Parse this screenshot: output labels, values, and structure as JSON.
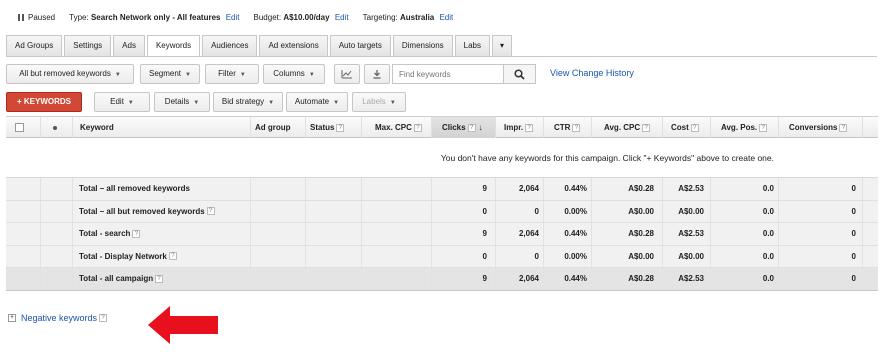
{
  "status": {
    "paused_label": "Paused",
    "type_label": "Type:",
    "type_value": "Search Network only - All features",
    "budget_label": "Budget:",
    "budget_value": "A$10.00/day",
    "targeting_label": "Targeting:",
    "targeting_value": "Australia",
    "edit_label": "Edit"
  },
  "tabs": [
    {
      "label": "Ad Groups"
    },
    {
      "label": "Settings"
    },
    {
      "label": "Ads"
    },
    {
      "label": "Keywords"
    },
    {
      "label": "Audiences"
    },
    {
      "label": "Ad extensions"
    },
    {
      "label": "Auto targets"
    },
    {
      "label": "Dimensions"
    },
    {
      "label": "Labs"
    },
    {
      "label": "▾"
    }
  ],
  "toolbar1": {
    "filter_select": "All but removed keywords",
    "segment": "Segment",
    "filter": "Filter",
    "columns": "Columns",
    "search_placeholder": "Find keywords",
    "view_change_history": "View Change History"
  },
  "toolbar2": {
    "add_keywords": "+ KEYWORDS",
    "edit": "Edit",
    "details": "Details",
    "bid_strategy": "Bid strategy",
    "automate": "Automate",
    "labels": "Labels"
  },
  "table": {
    "headers": {
      "keyword": "Keyword",
      "ad_group": "Ad group",
      "status": "Status",
      "max_cpc": "Max. CPC",
      "clicks": "Clicks",
      "impr": "Impr.",
      "ctr": "CTR",
      "avg_cpc": "Avg. CPC",
      "cost": "Cost",
      "avg_pos": "Avg. Pos.",
      "conversions": "Conversions"
    },
    "empty_message": "You don't have any keywords for this campaign. Click \"+ Keywords\" above to create one.",
    "rows": [
      {
        "label": "Total – all removed keywords",
        "clicks": "9",
        "impr": "2,064",
        "ctr": "0.44%",
        "avg_cpc": "A$0.28",
        "cost": "A$2.53",
        "avg_pos": "0.0",
        "conversions": "0"
      },
      {
        "label": "Total – all but removed keywords",
        "clicks": "0",
        "impr": "0",
        "ctr": "0.00%",
        "avg_cpc": "A$0.00",
        "cost": "A$0.00",
        "avg_pos": "0.0",
        "conversions": "0"
      },
      {
        "label": "Total - search",
        "clicks": "9",
        "impr": "2,064",
        "ctr": "0.44%",
        "avg_cpc": "A$0.28",
        "cost": "A$2.53",
        "avg_pos": "0.0",
        "conversions": "0"
      },
      {
        "label": "Total - Display Network",
        "clicks": "0",
        "impr": "0",
        "ctr": "0.00%",
        "avg_cpc": "A$0.00",
        "cost": "A$0.00",
        "avg_pos": "0.0",
        "conversions": "0"
      },
      {
        "label": "Total - all campaign",
        "clicks": "9",
        "impr": "2,064",
        "ctr": "0.44%",
        "avg_cpc": "A$0.28",
        "cost": "A$2.53",
        "avg_pos": "0.0",
        "conversions": "0"
      }
    ]
  },
  "negative_keywords": {
    "label": "Negative keywords"
  },
  "colors": {
    "accent_red": "#d14836",
    "link_blue": "#1a55a8",
    "arrow_red": "#e8101c"
  }
}
